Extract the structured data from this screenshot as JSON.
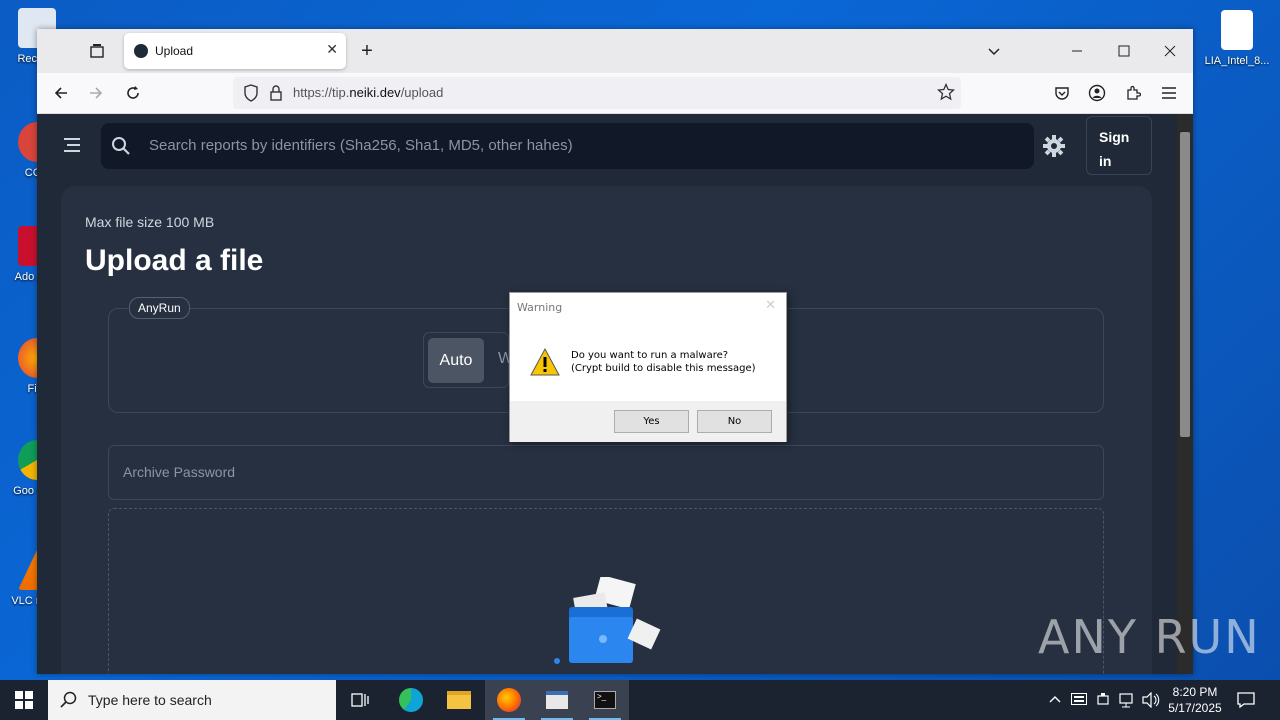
{
  "desktop": {
    "icons_left": [
      {
        "label": "Recycle"
      },
      {
        "label": "CCle"
      },
      {
        "label": "Ado Acro"
      },
      {
        "label": "Fire"
      },
      {
        "label": "Goo Chro"
      },
      {
        "label": "VLC m pla"
      }
    ],
    "icon_right": {
      "label": "LIA_Intel_8..."
    }
  },
  "browser": {
    "tab_title": "Upload",
    "url_prefix": "https://tip.",
    "url_domain": "neiki.dev",
    "url_path": "/upload"
  },
  "page": {
    "search_placeholder": "Search reports by identifiers (Sha256, Sha1, MD5, other hahes)",
    "signin_label": "Sign in",
    "max_size": "Max file size 100 MB",
    "heading": "Upload a file",
    "anyrun_tag": "AnyRun",
    "mode_auto": "Auto",
    "mode_w": "W",
    "archive_placeholder": "Archive Password"
  },
  "dialog": {
    "title": "Warning",
    "message_line1": "Do you want to run a malware?",
    "message_line2": "(Crypt build to disable this message)",
    "yes_label": "Yes",
    "no_label": "No"
  },
  "taskbar": {
    "search_placeholder": "Type here to search",
    "time": "8:20 PM",
    "date": "5/17/2025"
  },
  "watermark": "ANY RUN",
  "colors": {
    "page_bg": "#1f2937",
    "card_bg": "#263040",
    "desktop_blue": "#0a5fc7"
  }
}
